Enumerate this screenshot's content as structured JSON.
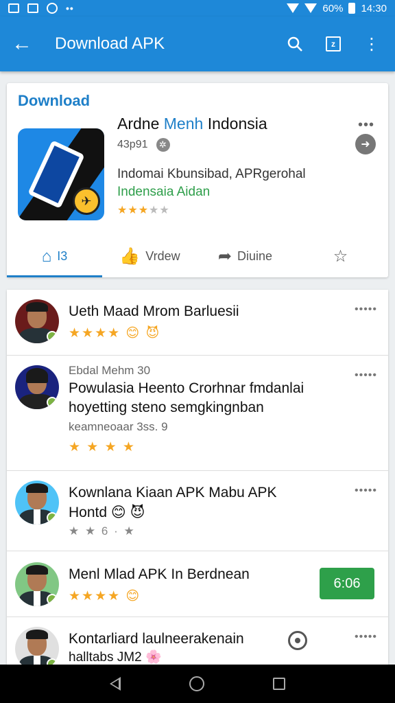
{
  "status_bar": {
    "battery": "60%",
    "time": "14:30"
  },
  "app_bar": {
    "title": "Download APK"
  },
  "app_card": {
    "section_label": "Download",
    "app_name_part1": "Ardne ",
    "app_name_highlight": "Menh",
    "app_name_part2": " Indonsia",
    "size": "43p91",
    "description_line1": "Indomai Kbunsibad, APRgerohal",
    "description_line2": "Indensaia Aidan",
    "rating_stars": 3,
    "tabs": [
      {
        "label": "I3",
        "icon": "home-icon"
      },
      {
        "label": "Vrdew",
        "icon": "thumb-up-icon"
      },
      {
        "label": "Diuine",
        "icon": "share-icon"
      },
      {
        "label": "",
        "icon": "star-outline-icon"
      }
    ]
  },
  "reviews": [
    {
      "name": "Ueth Maad Mrom Barluesii",
      "stars_text": "★★★★",
      "emoji": "😊 😈"
    },
    {
      "header": "Ebdal Mehm 30",
      "name_line1": "Powulasia Heento Crorhnar fmdanlai",
      "name_line2": "hoyetting steno semgkingnban",
      "sub": "keamneoaar 3ss. 9",
      "stars_text": "★ ★ ★ ★"
    },
    {
      "name_line1": "Kownlana Kiaan APK Mabu APK",
      "name_line2": "Hontd",
      "emoji": "😊 😈",
      "stars_text": "★ ★ 6 · ★"
    },
    {
      "name": "Menl Mlad APK In Berdnean",
      "stars_text": "★★★★",
      "emoji": "😊",
      "time": "6:06"
    },
    {
      "name_line1": "Kontarliard laulneerakenain",
      "name_line2": "halltabs JM2",
      "emoji": "🌸"
    }
  ],
  "colors": {
    "primary": "#1e88d8",
    "accent_green": "#2ea04a",
    "star": "#f5a623"
  }
}
